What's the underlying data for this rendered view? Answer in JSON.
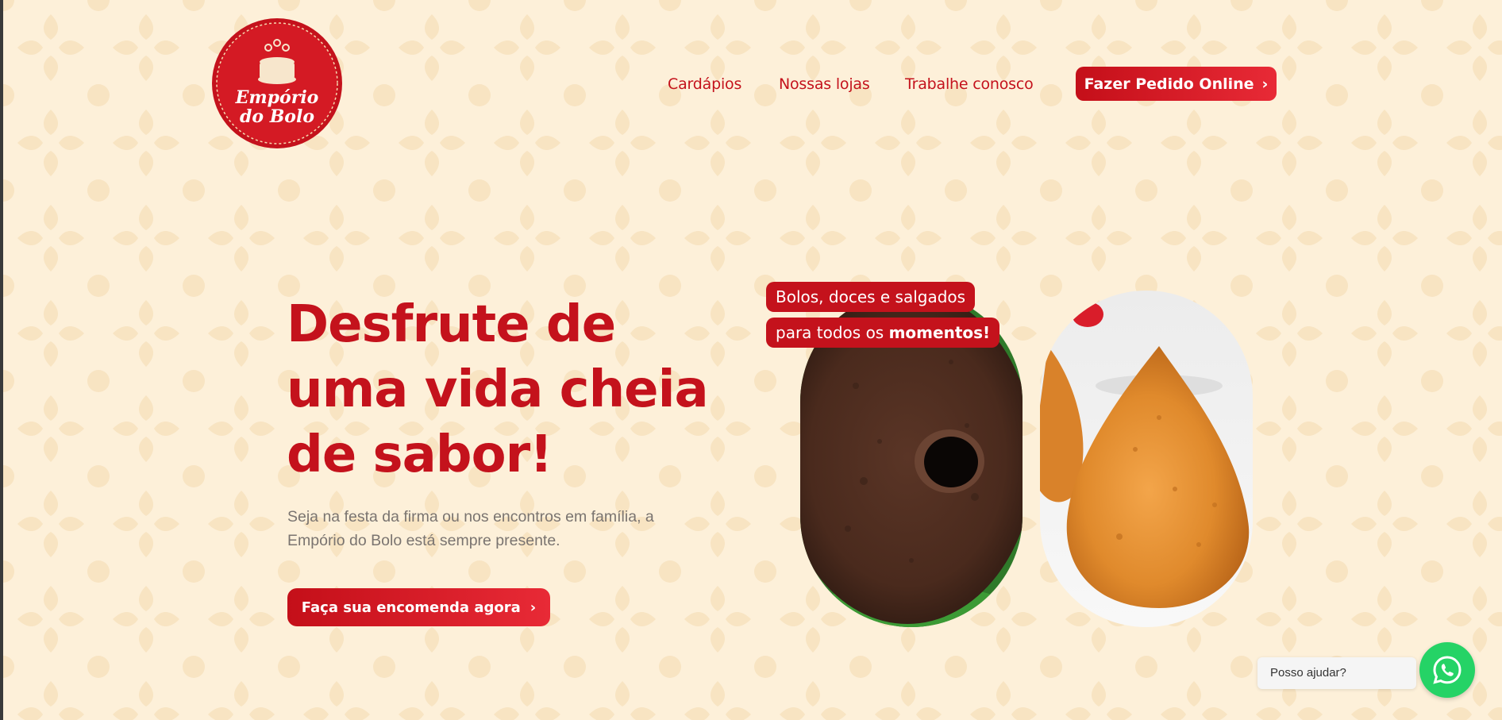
{
  "header": {
    "logo": {
      "line1": "Empório",
      "line2": "do Bolo"
    },
    "nav": [
      {
        "label": "Cardápios"
      },
      {
        "label": "Nossas lojas"
      },
      {
        "label": "Trabalhe conosco"
      }
    ],
    "order_button": {
      "label": "Fazer Pedido Online",
      "icon": "chevron-right-icon"
    }
  },
  "hero": {
    "title_lines": [
      "Desfrute de",
      "uma vida cheia",
      "de sabor!"
    ],
    "subtitle_lines": [
      "Seja na festa da firma ou nos encontros em família, a",
      "Empório do Bolo está sempre presente."
    ],
    "cta": {
      "label": "Faça sua encomenda agora",
      "icon": "chevron-right-icon"
    },
    "tag_line1": "Bolos, doces e salgados",
    "tag_line2_prefix": "para todos os ",
    "tag_line2_emphasis": "momentos!"
  },
  "chat": {
    "bubble_text": "Posso ajudar?",
    "icon": "whatsapp-icon"
  },
  "colors": {
    "brand_red": "#c4121c",
    "background": "#fdf0d9",
    "whatsapp_green": "#25d366"
  }
}
